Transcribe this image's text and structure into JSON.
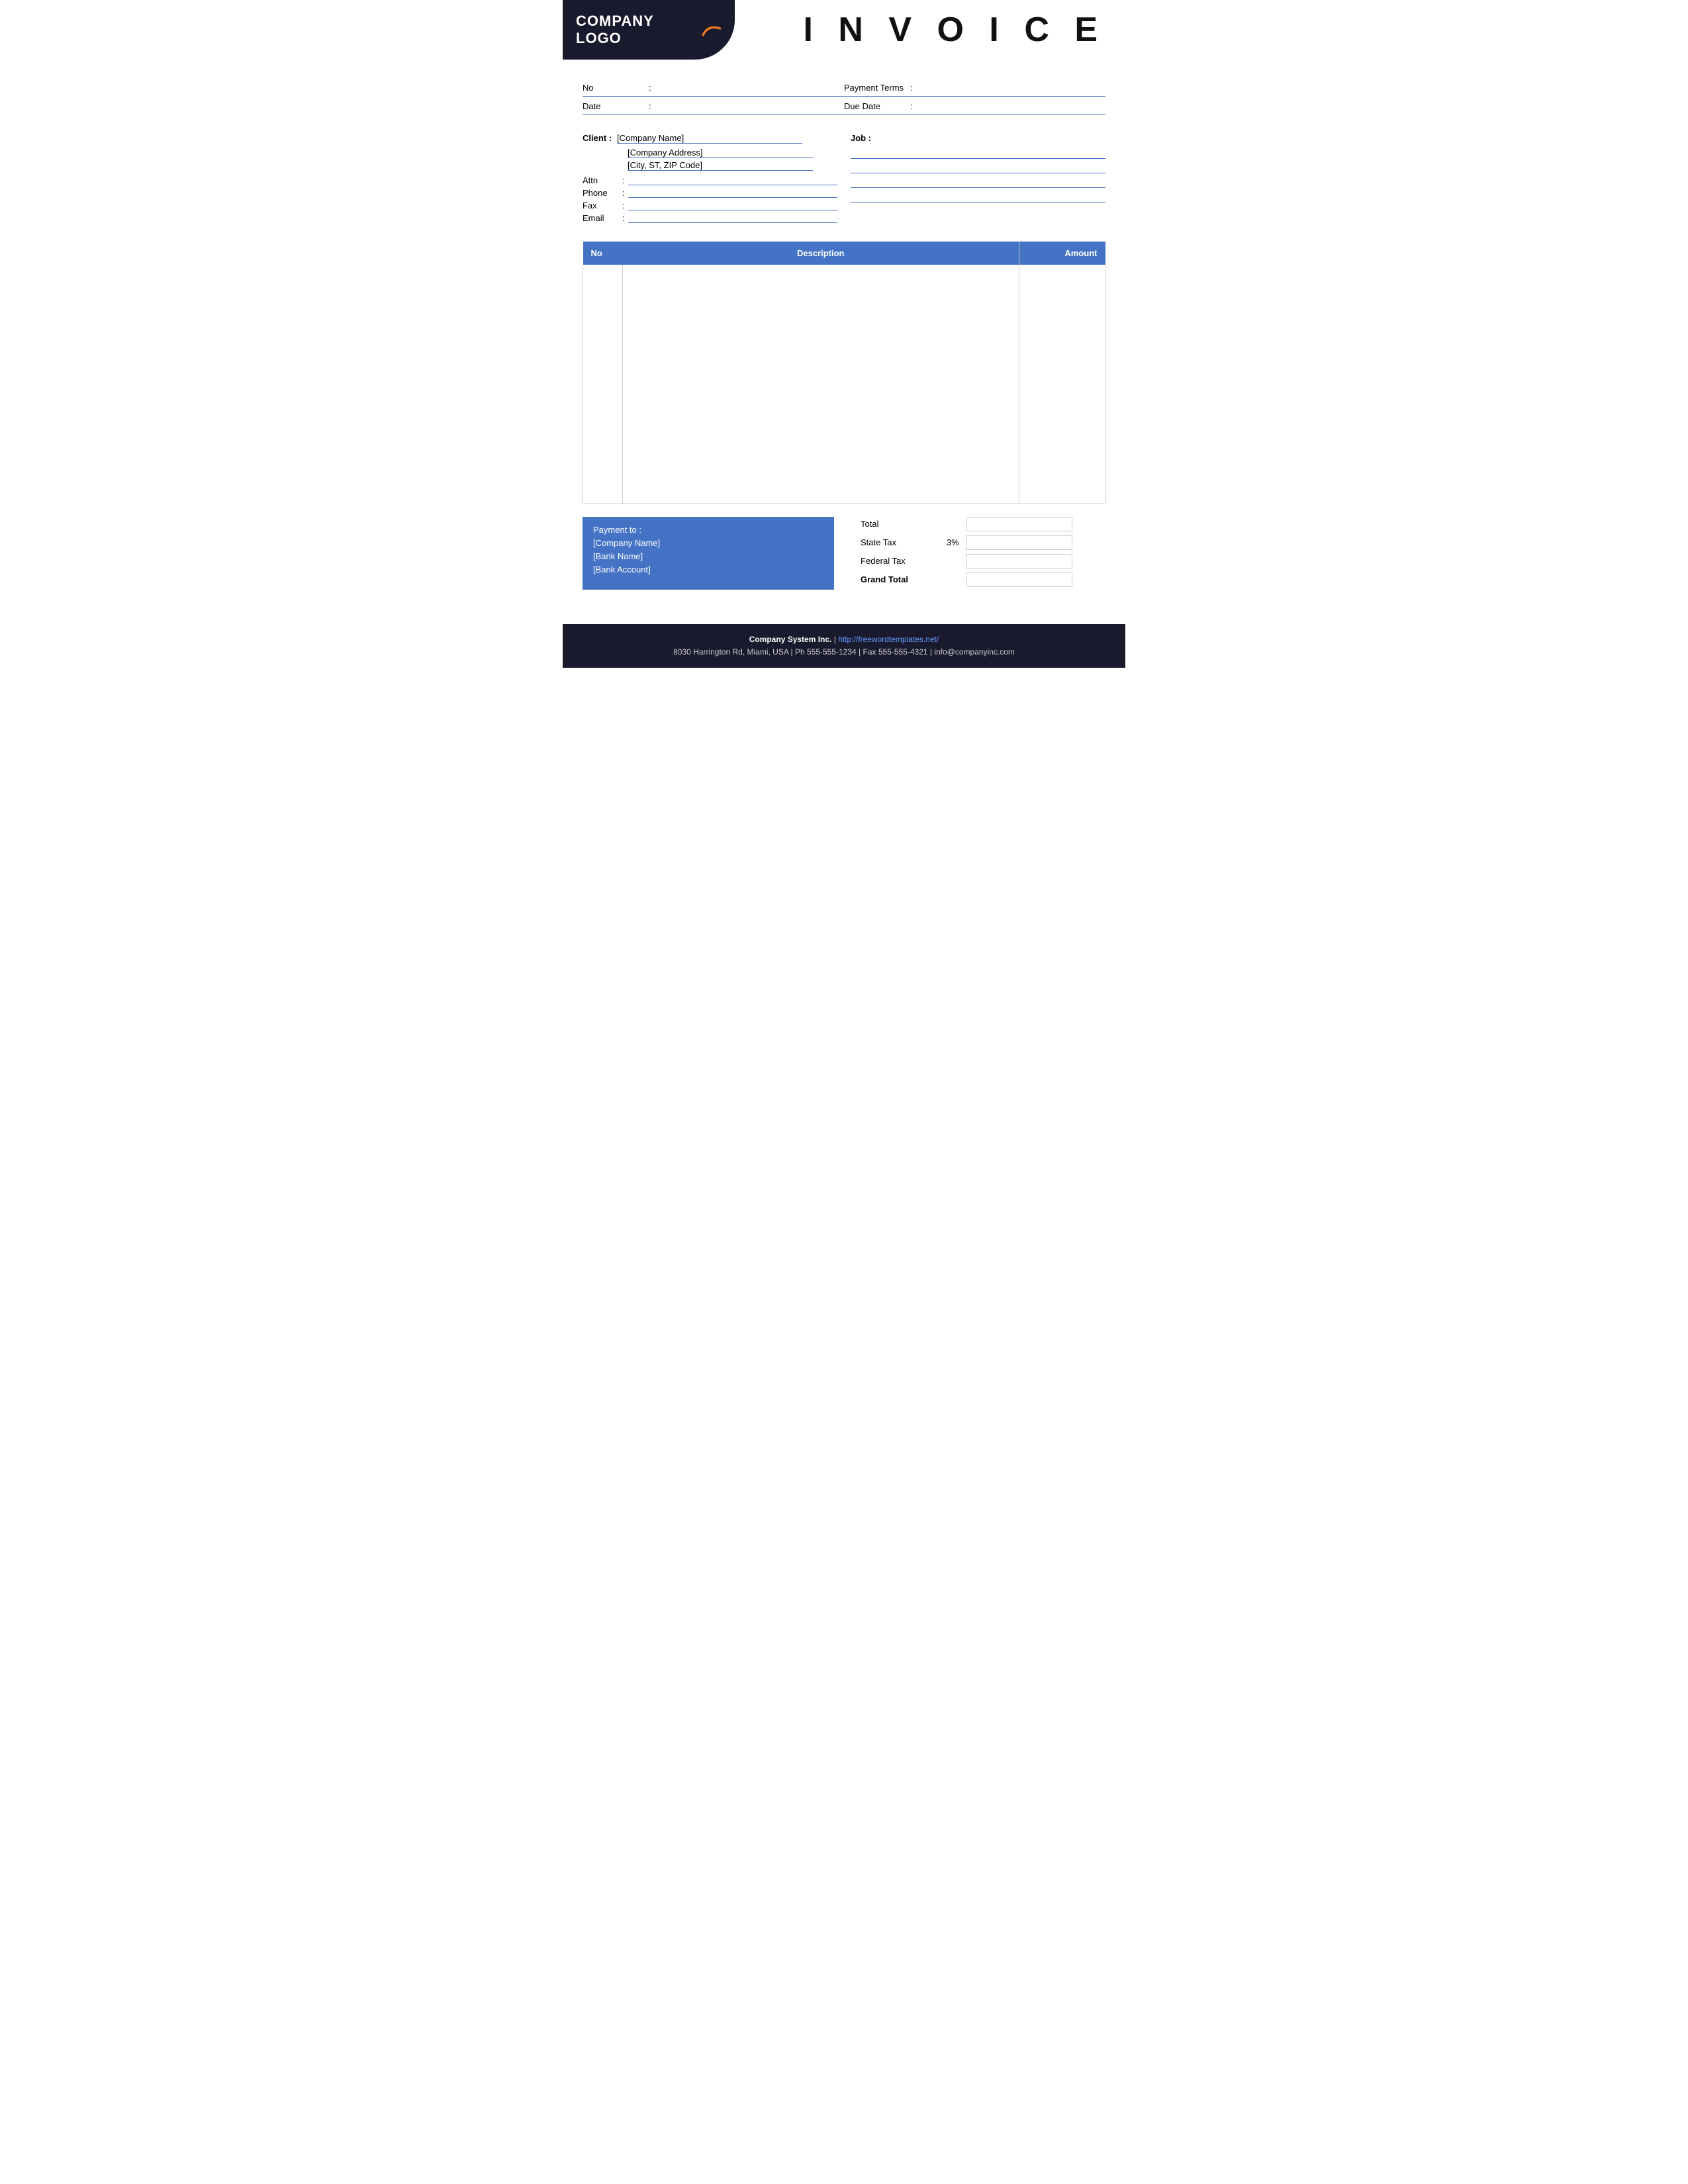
{
  "header": {
    "logo_text": "COMPANY LOGO",
    "invoice_title": "I N V O I C E"
  },
  "info": {
    "no_label": "No",
    "no_colon": ":",
    "no_value": "",
    "payment_terms_label": "Payment  Terms",
    "payment_terms_colon": ":",
    "payment_terms_value": "",
    "date_label": "Date",
    "date_colon": ":",
    "date_value": "",
    "due_date_label": "Due Date",
    "due_date_colon": ":",
    "due_date_value": ""
  },
  "client": {
    "label": "Client :",
    "company_name": "[Company Name]",
    "company_address": "[Company Address]",
    "city": "[City, ST, ZIP Code]",
    "attn_label": "Attn",
    "attn_colon": ":",
    "attn_value": "",
    "phone_label": "Phone",
    "phone_colon": ":",
    "phone_value": "",
    "fax_label": "Fax",
    "fax_colon": ":",
    "fax_value": "",
    "email_label": "Email",
    "email_colon": ":",
    "email_value": ""
  },
  "job": {
    "label": "Job :",
    "line1": "",
    "line2": "",
    "line3": "",
    "line4": ""
  },
  "table": {
    "col_no": "No",
    "col_description": "Description",
    "col_amount": "Amount",
    "rows": []
  },
  "payment": {
    "title": "Payment to :",
    "company_name": "[Company Name]",
    "bank_name": "[Bank Name]",
    "bank_account": "[Bank Account]"
  },
  "totals": {
    "total_label": "Total",
    "state_tax_label": "State Tax",
    "state_tax_pct": "3%",
    "federal_tax_label": "Federal Tax",
    "grand_total_label": "Grand Total",
    "total_value": "",
    "state_tax_value": "",
    "federal_tax_value": "",
    "grand_total_value": ""
  },
  "footer": {
    "company": "Company System Inc.",
    "separator": "|",
    "website": "http://freewordtemplates.net/",
    "address": "8030 Harrington Rd, Miami, USA | Ph 555-555-1234 | Fax 555-555-4321 | info@companyinc.com"
  }
}
